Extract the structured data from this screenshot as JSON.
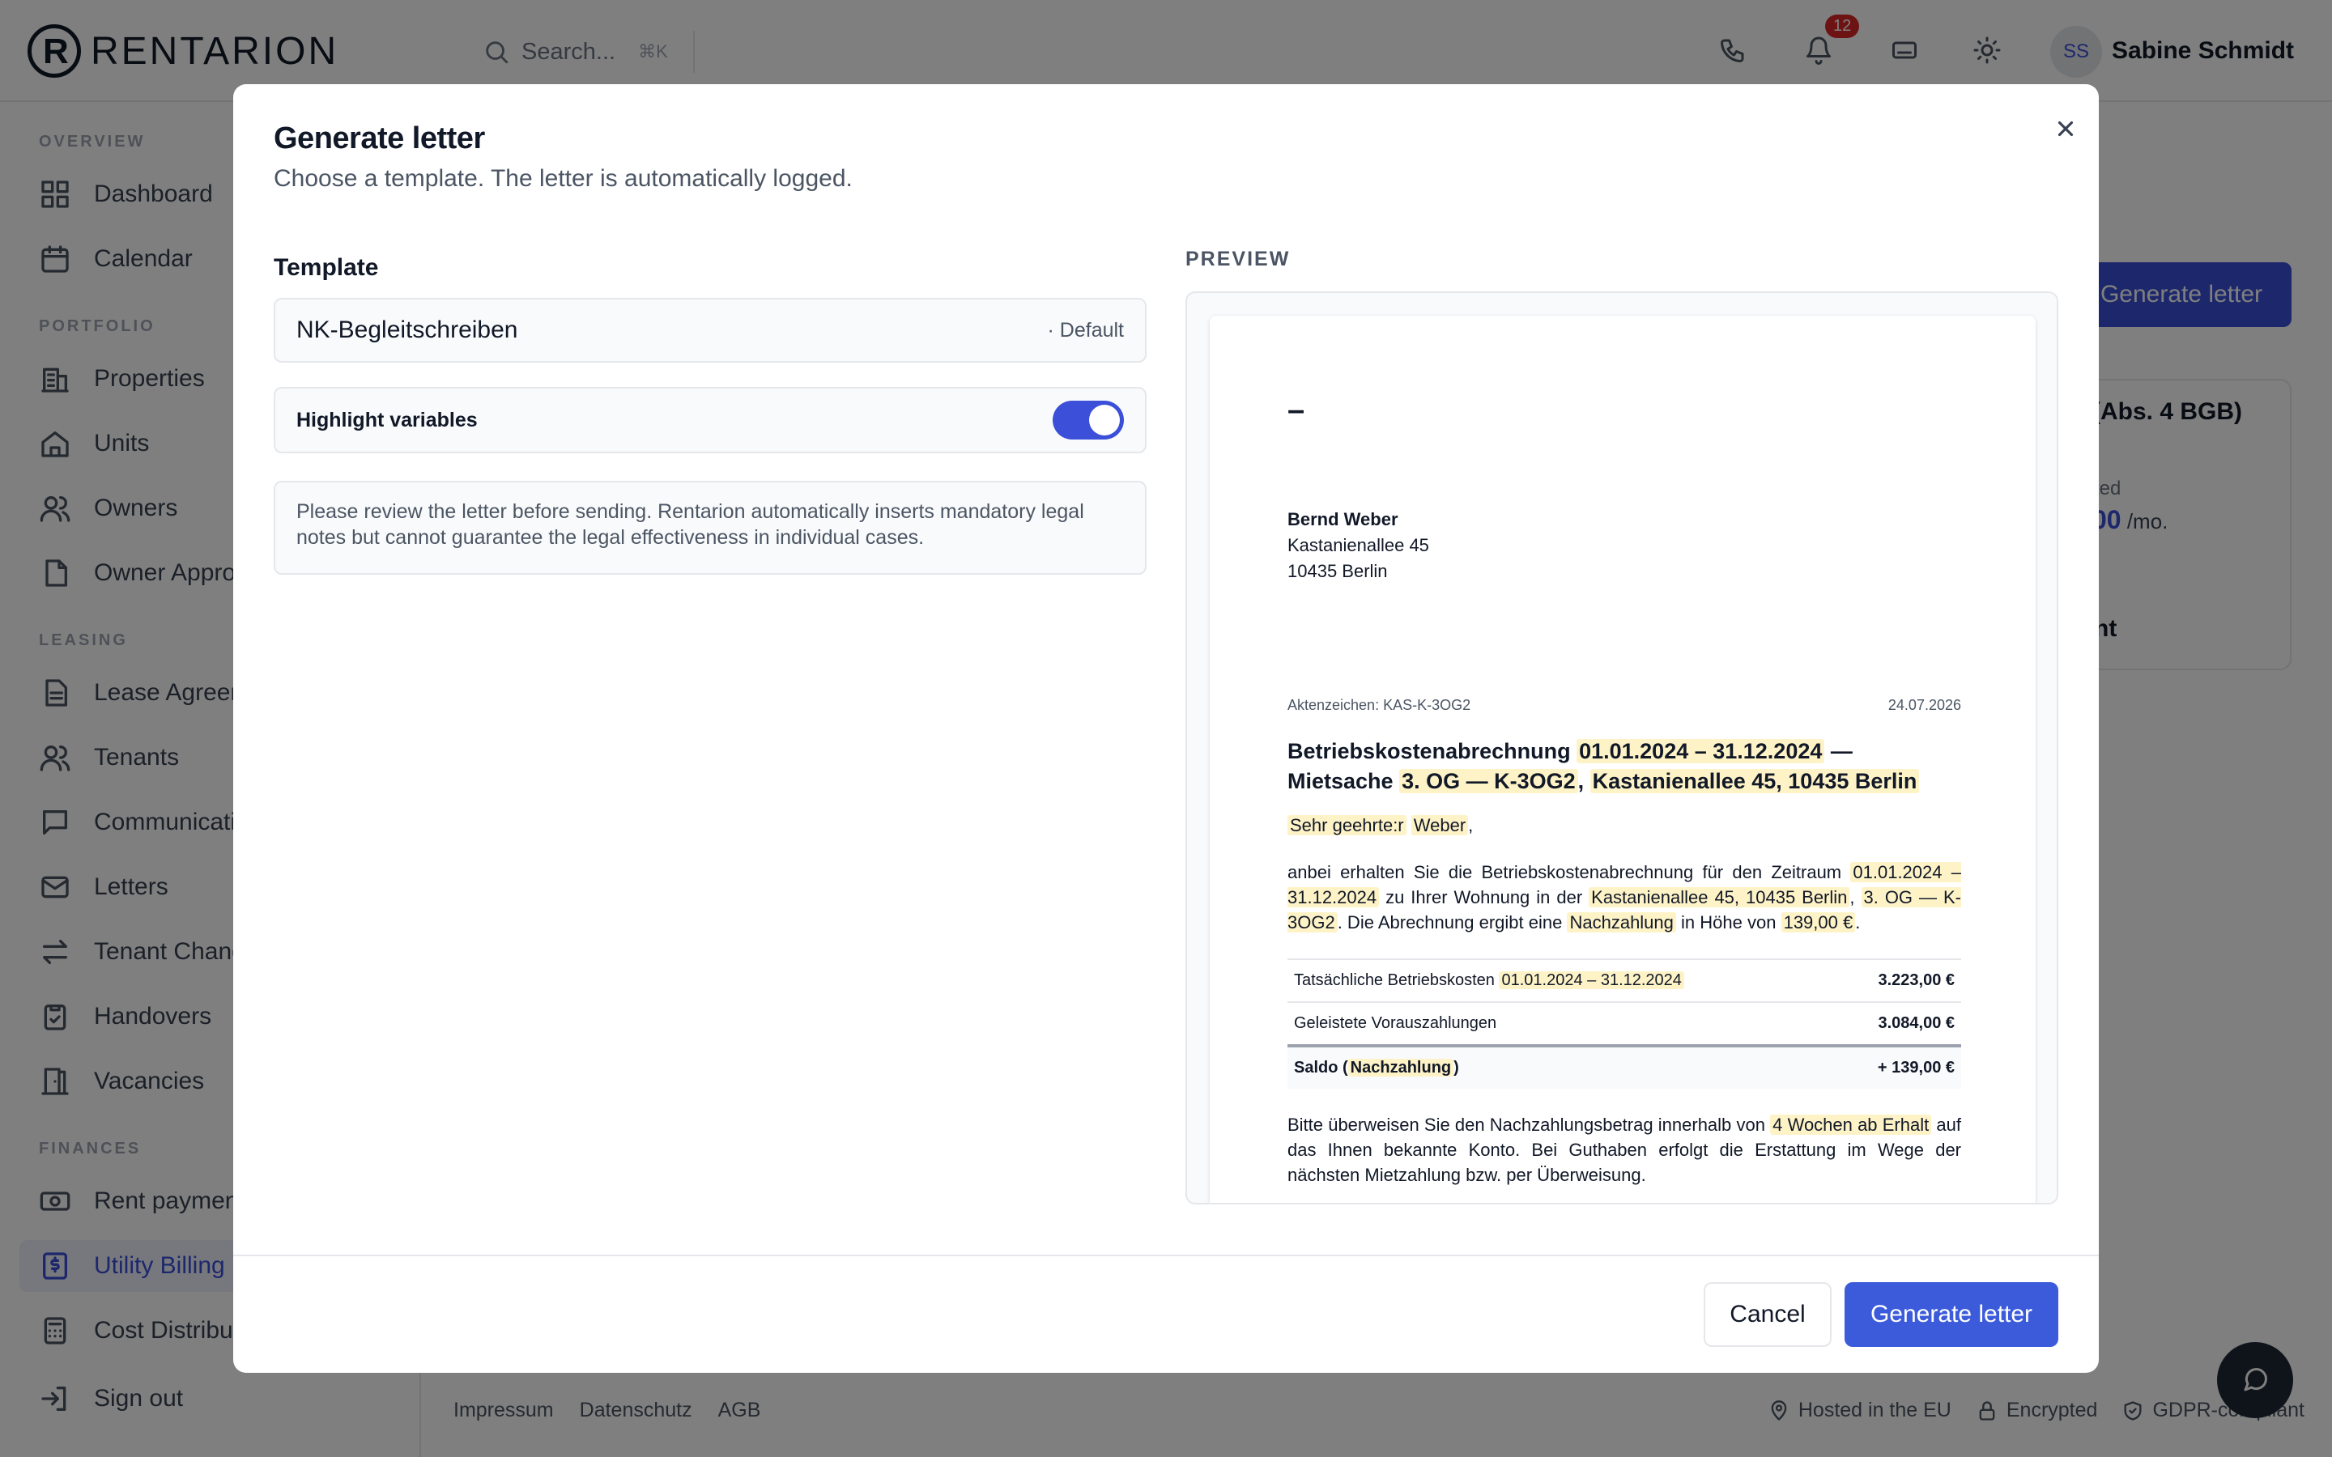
{
  "app": {
    "brand": "RENTARION",
    "logo_letter": "R"
  },
  "topbar": {
    "search_placeholder": "Search...",
    "search_shortcut": "⌘K",
    "notifications_count": "12",
    "user": {
      "initials": "SS",
      "name": "Sabine Schmidt"
    },
    "icons": [
      "phone-icon",
      "bell-icon",
      "keyboard-icon",
      "sun-icon"
    ]
  },
  "sidebar": {
    "sections": {
      "overview": "OVERVIEW",
      "portfolio": "PORTFOLIO",
      "leasing": "LEASING",
      "finances": "FINANCES"
    },
    "items": [
      {
        "label": "Dashboard",
        "icon": "grid-icon"
      },
      {
        "label": "Calendar",
        "icon": "calendar-icon"
      },
      {
        "label": "Properties",
        "icon": "building-icon"
      },
      {
        "label": "Units",
        "icon": "home-icon"
      },
      {
        "label": "Owners",
        "icon": "users-icon"
      },
      {
        "label": "Owner Appro",
        "icon": "file-icon"
      },
      {
        "label": "Lease Agreem",
        "icon": "document-icon"
      },
      {
        "label": "Tenants",
        "icon": "users-icon"
      },
      {
        "label": "Communicati",
        "icon": "message-icon"
      },
      {
        "label": "Letters",
        "icon": "mail-icon"
      },
      {
        "label": "Tenant Chang",
        "icon": "swap-icon"
      },
      {
        "label": "Handovers",
        "icon": "clipboard-icon"
      },
      {
        "label": "Vacancies",
        "icon": "door-icon"
      },
      {
        "label": "Rent paymen",
        "icon": "cash-icon"
      },
      {
        "label": "Utility Billing",
        "icon": "dollar-file-icon",
        "active": true
      },
      {
        "label": "Cost Distribu",
        "icon": "calculator-icon"
      },
      {
        "label": "Sign out",
        "icon": "logout-icon"
      }
    ]
  },
  "background": {
    "generate_button": "Generate letter",
    "card_title": "(Abs. 4 BGB)",
    "card_label": "ted",
    "card_value": "00",
    "card_unit": " /mo.",
    "card_tab": "nt"
  },
  "footer": {
    "links": [
      "Impressum",
      "Datenschutz",
      "AGB"
    ],
    "badges": [
      "Hosted in the EU",
      "Encrypted",
      "GDPR-compliant"
    ]
  },
  "modal": {
    "title": "Generate letter",
    "subtitle": "Choose a template. The letter is automatically logged.",
    "template_label": "Template",
    "template_value": "NK-Begleitschreiben",
    "template_default": "· Default",
    "highlight_label": "Highlight variables",
    "highlight_on": true,
    "notice": "Please review the letter before sending. Rentarion automatically inserts mandatory legal notes but cannot guarantee the legal effectiveness in individual cases.",
    "preview_label": "PREVIEW",
    "cancel": "Cancel",
    "submit": "Generate letter"
  },
  "letter": {
    "dash": "–",
    "recipient": {
      "name": "Bernd Weber",
      "street": "Kastanienallee 45",
      "city": "10435 Berlin"
    },
    "reference": "Aktenzeichen: KAS-K-3OG2",
    "date": "24.07.2026",
    "subject_prefix": "Betriebskostenabrechnung",
    "period": "01.01.2024 – 31.12.2024",
    "subject_mid": "— Mietsache",
    "unit": "3. OG — K-3OG2",
    "address": "Kastanienallee 45, 10435 Berlin",
    "salutation": "Sehr geehrte:r",
    "surname": "Weber",
    "body_1a": "anbei erhalten Sie die Betriebskostenabrechnung für den Zeitraum",
    "body_1b": "zu Ihrer Wohnung in der",
    "body_1c": ". Die Abrechnung ergibt eine",
    "result_word": "Nachzahlung",
    "body_1d": "in Höhe von",
    "amount": "139,00 €",
    "table": {
      "row1_label": "Tatsächliche Betriebskosten",
      "row1_value": "3.223,00 €",
      "row2_label": "Geleistete Vorauszahlungen",
      "row2_value": "3.084,00 €",
      "row3_label": "Saldo (",
      "row3_label_end": ")",
      "row3_value": "+ 139,00 €"
    },
    "body_2a": "Bitte überweisen Sie den Nachzahlungsbetrag innerhalb von",
    "deadline": "4 Wochen ab Erhalt",
    "body_2b": "auf das Ihnen bekannte Konto. Bei Guthaben erfolgt die Erstattung im Wege der nächsten Mietzahlung bzw. per Überweisung."
  },
  "colors": {
    "accent": "#3b4fd8",
    "highlight": "#fef3c7",
    "overlay": "rgba(0,0,0,0.5)"
  }
}
